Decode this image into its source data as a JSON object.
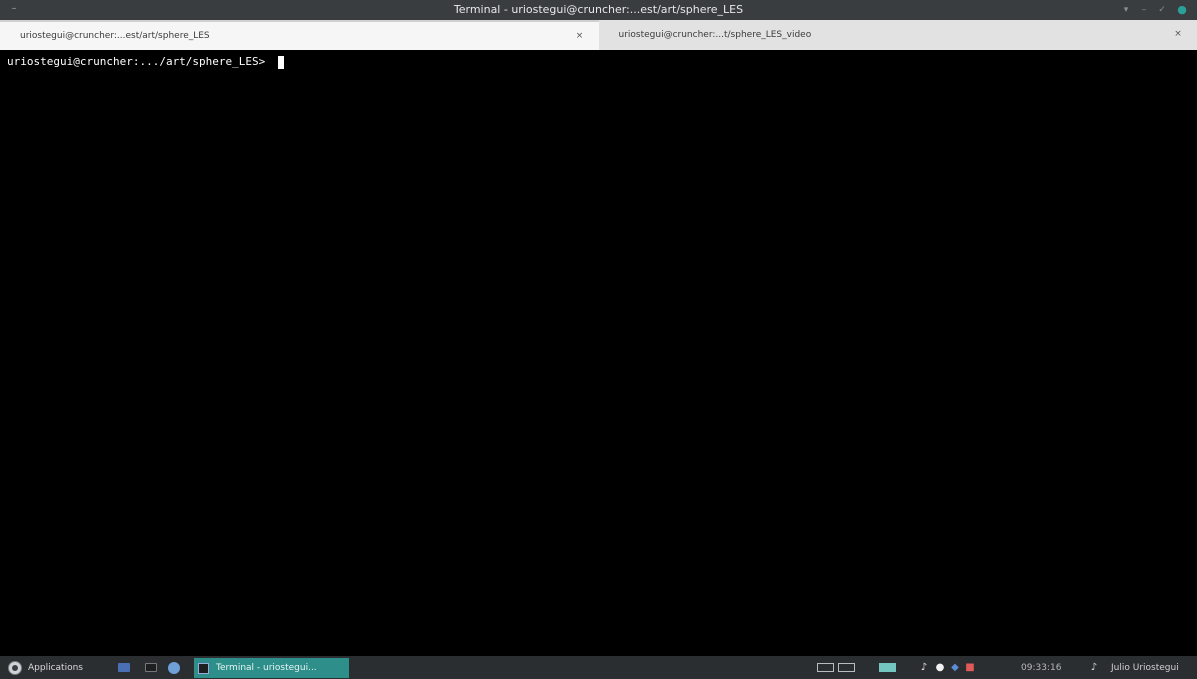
{
  "window": {
    "title": "Terminal - uriostegui@cruncher:...est/art/sphere_LES",
    "menu_glyph": "–",
    "controls": {
      "shade": "▾",
      "minimize": "–",
      "maximize": "✓",
      "close": "●"
    }
  },
  "tabs": [
    {
      "label": "uriostegui@cruncher:...est/art/sphere_LES",
      "close": "×",
      "active": true
    },
    {
      "label": "uriostegui@cruncher:...t/sphere_LES_video",
      "close": "×",
      "active": false
    }
  ],
  "terminal": {
    "prompt": "uriostegui@cruncher:.../art/sphere_LES>"
  },
  "taskbar": {
    "applications_label": "Applications",
    "active_task_label": "Terminal - uriostegui...",
    "clock": "09:33:16",
    "user": "Julio Uriostegui",
    "icons": {
      "volume": "♪",
      "update": "●",
      "network": "◆",
      "record": "■",
      "bell": "♪"
    }
  },
  "colors": {
    "titlebar": "#3a3d40",
    "tabbar": "#ececec",
    "terminal_bg": "#000000",
    "taskbar": "#2b2e31",
    "accent": "#2e8f8a"
  }
}
